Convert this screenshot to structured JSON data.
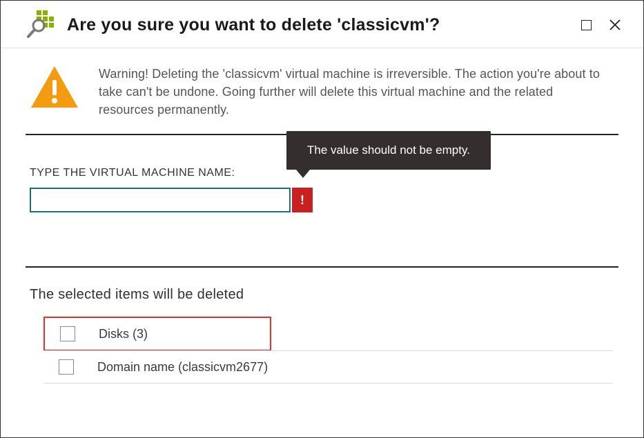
{
  "title": "Are you sure you want to delete 'classicvm'?",
  "warning_text": "Warning! Deleting the 'classicvm' virtual machine is irreversible. The action you're about to take can't be undone. Going further will delete this virtual machine and the related resources permanently.",
  "input_label": "TYPE THE VIRTUAL MACHINE NAME:",
  "input_value": "",
  "tooltip_text": "The value should not be empty.",
  "error_badge": "!",
  "items_heading": "The selected items will be deleted",
  "items": [
    {
      "label": "Disks (3)",
      "checked": false,
      "highlight": true
    },
    {
      "label": "Domain name (classicvm2677)",
      "checked": false,
      "highlight": false
    }
  ]
}
